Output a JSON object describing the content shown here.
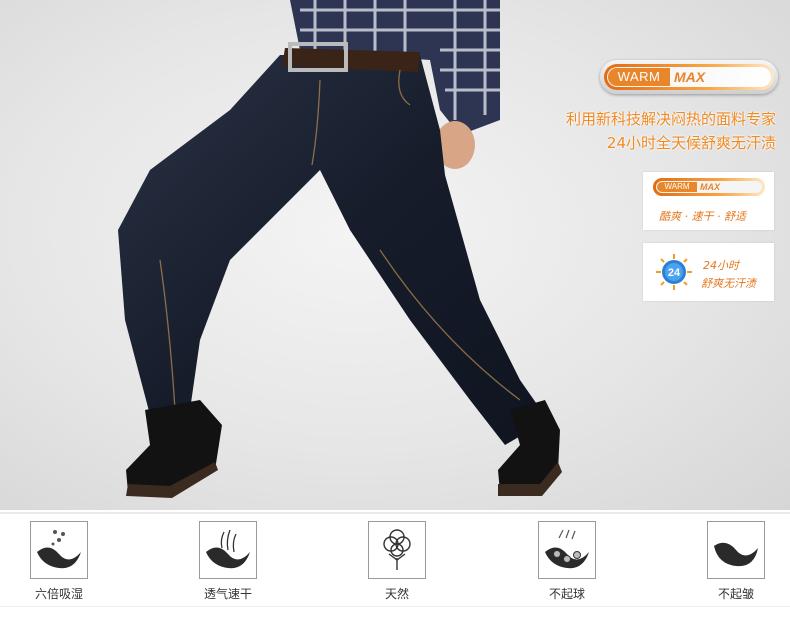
{
  "hero": {
    "badge": {
      "warm": "WARM",
      "max": "MAX"
    },
    "slogan_line1": "利用新科技解决闷热的面料专家",
    "slogan_line2": "24小时全天候舒爽无汗渍",
    "card1": {
      "warm": "WARM",
      "max": "MAX",
      "text": "酷爽 · 速干 · 舒适"
    },
    "card2": {
      "line1": "24小时",
      "line2": "舒爽无汗渍",
      "sun_number": "24"
    }
  },
  "features": [
    {
      "label": "六倍吸湿",
      "icon": "moisture-absorb-icon"
    },
    {
      "label": "透气速干",
      "icon": "breathable-dry-icon"
    },
    {
      "label": "天然",
      "icon": "cotton-flower-icon"
    },
    {
      "label": "不起球",
      "icon": "anti-pilling-icon"
    },
    {
      "label": "不起皱",
      "icon": "anti-wrinkle-icon"
    }
  ],
  "colors": {
    "accent_orange": "#f08a22",
    "denim": "#1c2233",
    "icon_dark": "#2a2a2a"
  }
}
